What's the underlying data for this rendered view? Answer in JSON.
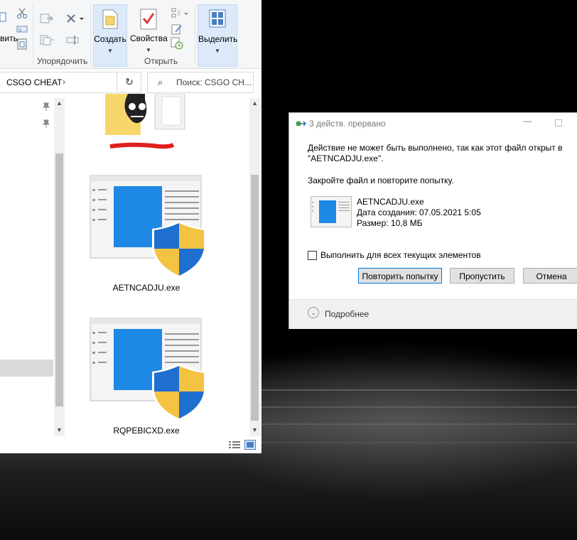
{
  "explorer": {
    "ribbon": {
      "organize_group_label": "Упорядочить",
      "open_group_label": "Открыть",
      "partial_left_label": "вить",
      "create_label": "Создать",
      "properties_label": "Свойства",
      "select_label": "Выделить"
    },
    "address": {
      "path": "CSGO CHEAT",
      "chevron": "›"
    },
    "search": {
      "placeholder": "Поиск: CSGO CH..."
    },
    "files": [
      {
        "name": "AETNCADJU.exe"
      },
      {
        "name": "RQPEBICXD.exe"
      }
    ]
  },
  "dialog": {
    "title": "3 действ. прервано",
    "message_line1": "Действие не может быть выполнено, так как этот файл открыт в",
    "message_line2": "\"AETNCADJU.exe\".",
    "message_hint": "Закройте файл и повторите попытку.",
    "file_name": "AETNCADJU.exe",
    "file_created": "Дата создания: 07.05.2021 5:05",
    "file_size": "Размер: 10,8 МБ",
    "apply_all_label": "Выполнить для всех текущих элементов",
    "apply_all_checked": false,
    "buttons": {
      "retry": "Повторить попытку",
      "skip": "Пропустить",
      "cancel": "Отмена"
    },
    "details_label": "Подробнее"
  },
  "colors": {
    "accent": "#0078d7",
    "ribbon_selected": "#dbe9f8",
    "shield_blue": "#1e6fd0",
    "shield_yellow": "#f5c342",
    "folder": "#f7d66b"
  },
  "icons": {
    "refresh": "↻",
    "search": "⌕",
    "details_chevron": "⌄",
    "minimize": "—"
  }
}
